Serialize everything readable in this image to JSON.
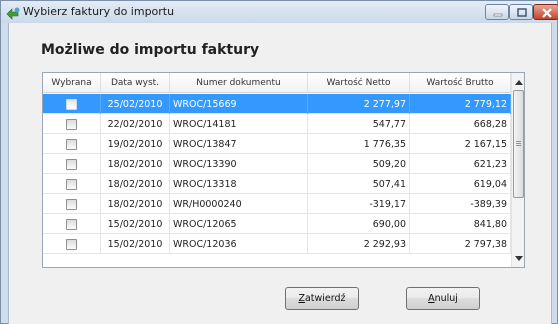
{
  "window": {
    "title": "Wybierz faktury do importu"
  },
  "heading": "Możliwe do importu faktury",
  "table": {
    "columns": [
      "Wybrana",
      "Data wyst.",
      "Numer dokumentu",
      "Wartość Netto",
      "Wartość Brutto"
    ],
    "rows": [
      {
        "selected": true,
        "checked": false,
        "date": "25/02/2010",
        "number": "WROC/15669",
        "net": "2 277,97",
        "gross": "2 779,12"
      },
      {
        "selected": false,
        "checked": false,
        "date": "22/02/2010",
        "number": "WROC/14181",
        "net": "547,77",
        "gross": "668,28"
      },
      {
        "selected": false,
        "checked": false,
        "date": "19/02/2010",
        "number": "WROC/13847",
        "net": "1 776,35",
        "gross": "2 167,15"
      },
      {
        "selected": false,
        "checked": false,
        "date": "18/02/2010",
        "number": "WROC/13390",
        "net": "509,20",
        "gross": "621,23"
      },
      {
        "selected": false,
        "checked": false,
        "date": "18/02/2010",
        "number": "WROC/13318",
        "net": "507,41",
        "gross": "619,04"
      },
      {
        "selected": false,
        "checked": false,
        "date": "18/02/2010",
        "number": "WR/H0000240",
        "net": "-319,17",
        "gross": "-389,39"
      },
      {
        "selected": false,
        "checked": false,
        "date": "15/02/2010",
        "number": "WROC/12065",
        "net": "690,00",
        "gross": "841,80"
      },
      {
        "selected": false,
        "checked": false,
        "date": "15/02/2010",
        "number": "WROC/12036",
        "net": "2 292,93",
        "gross": "2 797,38"
      }
    ]
  },
  "buttons": {
    "ok_mnemonic": "Z",
    "ok_rest": "atwierdź",
    "cancel_mnemonic": "A",
    "cancel_rest": "nuluj"
  },
  "colors": {
    "selection": "#3399ff",
    "window_frame": "#cfdcec"
  },
  "icons": {
    "app": "import-icon",
    "minimize": "minimize-icon",
    "maximize": "maximize-icon",
    "close": "close-icon"
  }
}
